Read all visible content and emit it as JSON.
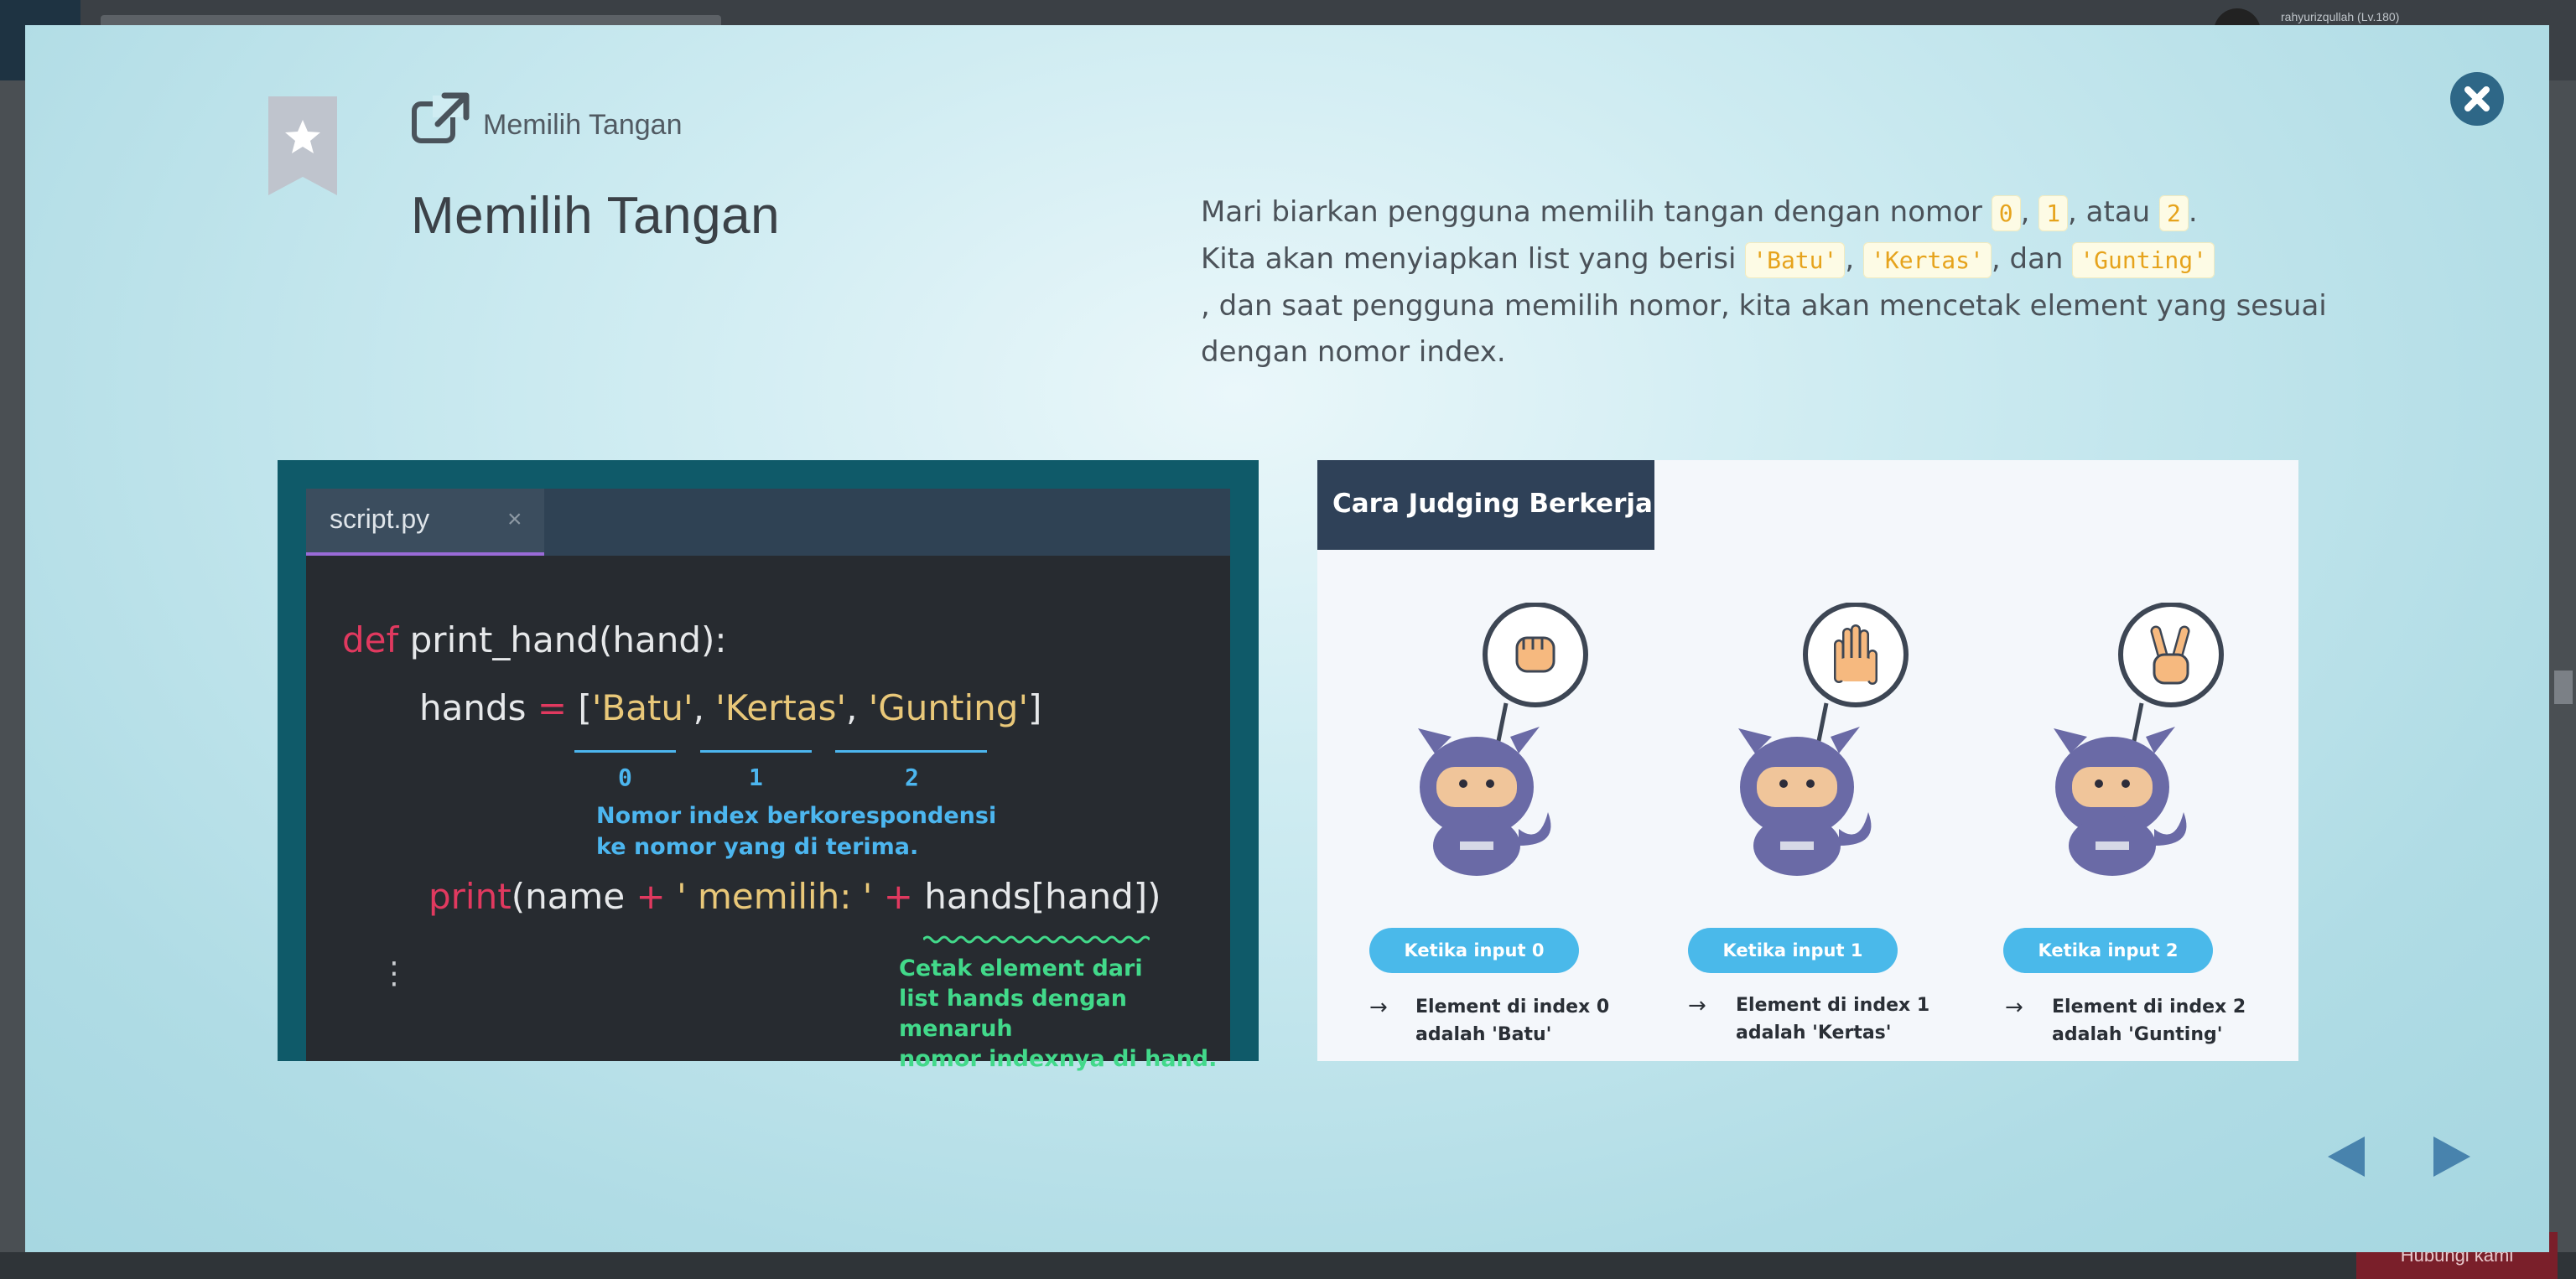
{
  "background": {
    "username": "rahyurizqullah (Lv.180)",
    "help_button": "Hubungi kami"
  },
  "modal": {
    "category_label": "Memilih Tangan",
    "title": "Memilih Tangan",
    "description": {
      "line1_prefix": "Mari biarkan pengguna memilih tangan dengan nomor ",
      "num0": "0",
      "num1": "1",
      "num2": "2",
      "sep_comma": ", ",
      "atau": ", atau ",
      "line1_suffix": ".",
      "line2_prefix": "Kita akan menyiapkan list yang berisi ",
      "item_batu": "'Batu'",
      "item_kertas": "'Kertas'",
      "dan": ", dan ",
      "item_gunting": "'Gunting'",
      "line3": ", dan saat pengguna memilih nomor, kita akan mencetak element yang sesuai dengan nomor index."
    }
  },
  "code_panel": {
    "tab_label": "script.py",
    "tab_close": "×",
    "line1": {
      "kw": "def",
      "rest": " print_hand(hand):"
    },
    "line2": {
      "lhs": "hands ",
      "eq": "=",
      "open": " [",
      "s1": "'Batu'",
      "c1": ", ",
      "s2": "'Kertas'",
      "c2": ", ",
      "s3": "'Gunting'",
      "close": "]"
    },
    "indices": [
      "0",
      "1",
      "2"
    ],
    "note_index": [
      "Nomor index berkorespondensi",
      "ke nomor yang di terima."
    ],
    "line3": {
      "kw": "print",
      "a": "(name ",
      "p1": "+",
      "s": " ' memilih: '",
      "p2": " +",
      "b": " hands[hand])"
    },
    "note_print": [
      "Cetak element dari",
      "list hands dengan menaruh",
      "nomor indexnya di hand."
    ],
    "ellipsis": "⋮"
  },
  "judging_panel": {
    "title": "Cara Judging Berkerja",
    "cases": [
      {
        "pill": "Ketika input 0",
        "result": [
          "Element di index 0",
          "adalah 'Batu'"
        ],
        "hand_icon": "rock-fist-icon"
      },
      {
        "pill": "Ketika input 1",
        "result": [
          "Element di index 1",
          "adalah 'Kertas'"
        ],
        "hand_icon": "paper-hand-icon"
      },
      {
        "pill": "Ketika input 2",
        "result": [
          "Element di index 2",
          "adalah 'Gunting'"
        ],
        "hand_icon": "scissors-hand-icon"
      }
    ],
    "arrow": "→"
  },
  "colors": {
    "accent": "#2e6787",
    "nav": "#4883ad",
    "pill": "#4ab9ea",
    "code_keyword": "#e1395f",
    "code_string": "#e9c879",
    "note_blue": "#4cb6ef",
    "note_green": "#42d98a"
  }
}
